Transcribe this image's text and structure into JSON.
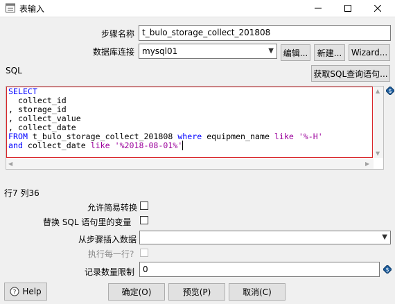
{
  "window": {
    "title": "表输入",
    "icon": "table-input-icon"
  },
  "form": {
    "step_name_label": "步骤名称",
    "step_name_value": "t_bulo_storage_collect_201808",
    "connection_label": "数据库连接",
    "connection_value": "mysql01",
    "edit_button": "编辑...",
    "new_button": "新建...",
    "wizard_button": "Wizard...",
    "sql_label": "SQL",
    "get_sql_button": "获取SQL查询语句...",
    "cursor_position": "行7 列36",
    "lazy_conversion_label": "允许简易转换",
    "replace_variables_label": "替换 SQL 语句里的变量",
    "insert_from_step_label": "从步骤插入数据",
    "insert_from_step_value": "",
    "execute_each_row_label": "执行每一行?",
    "limit_label": "记录数量限制",
    "limit_value": "0"
  },
  "sql": {
    "line1_kw": "SELECT",
    "line2": "  collect_id",
    "line3": ", storage_id",
    "line4": ", collect_value",
    "line5": ", collect_date",
    "line6_kw1": "FROM",
    "line6_id": " t_bulo_storage_collect_201808 ",
    "line6_kw2": "where",
    "line6_id2": " equipmen_name ",
    "line6_kw3": "like",
    "line6_str": " '%-H'",
    "line7_kw1": "and",
    "line7_id": " collect_date ",
    "line7_kw2": "like",
    "line7_str": " '%2018-08-01%'"
  },
  "footer": {
    "help_button": "Help",
    "ok_button": "确定(O)",
    "preview_button": "预览(P)",
    "cancel_button": "取消(C)"
  },
  "colors": {
    "keyword": "#0000ff",
    "string": "#9b009b",
    "editor_border": "#d9262a"
  }
}
